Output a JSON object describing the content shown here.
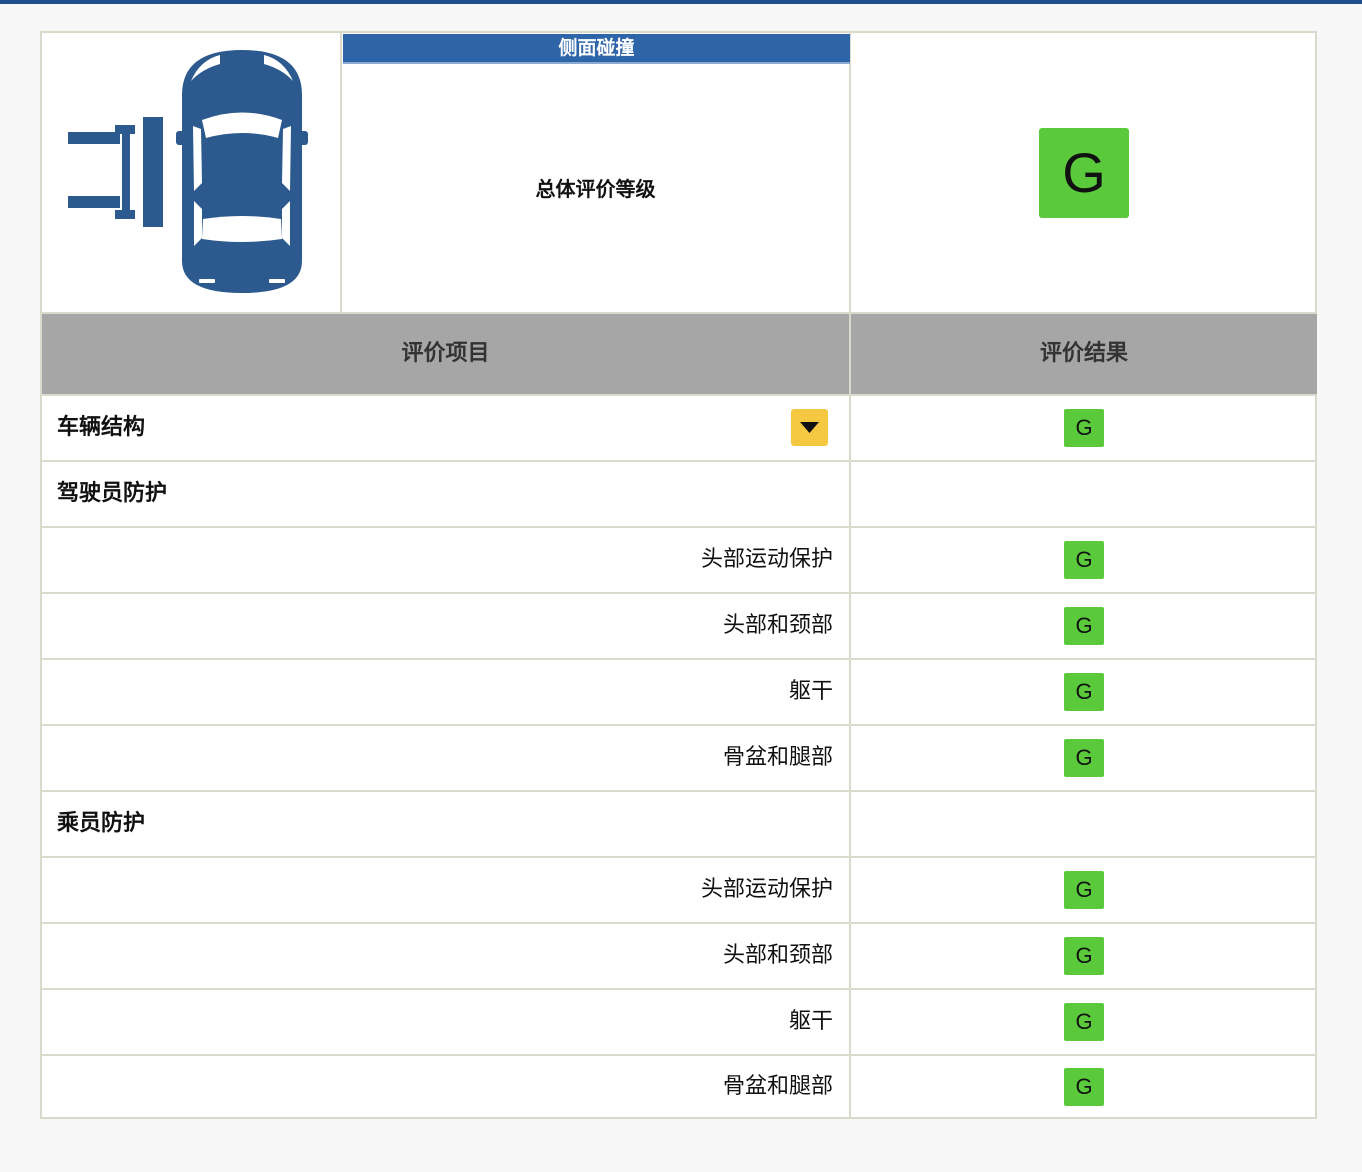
{
  "header": {
    "test_title": "侧面碰撞",
    "overall_label": "总体评价等级",
    "overall_rating": "G"
  },
  "columns": {
    "item": "评价项目",
    "result": "评价结果"
  },
  "rows": [
    {
      "type": "section",
      "label": "车辆结构",
      "rating": "G",
      "has_dropdown": true
    },
    {
      "type": "section",
      "label": "驾驶员防护"
    },
    {
      "type": "item",
      "label": "头部运动保护",
      "rating": "G"
    },
    {
      "type": "item",
      "label": "头部和颈部",
      "rating": "G"
    },
    {
      "type": "item",
      "label": "躯干",
      "rating": "G"
    },
    {
      "type": "item",
      "label": "骨盆和腿部",
      "rating": "G"
    },
    {
      "type": "section",
      "label": "乘员防护"
    },
    {
      "type": "item",
      "label": "头部运动保护",
      "rating": "G"
    },
    {
      "type": "item",
      "label": "头部和颈部",
      "rating": "G"
    },
    {
      "type": "item",
      "label": "躯干",
      "rating": "G"
    },
    {
      "type": "item",
      "label": "骨盆和腿部",
      "rating": "G"
    }
  ],
  "icons": {
    "car": "side-impact-car-icon",
    "dropdown": "chevron-down-icon"
  },
  "colors": {
    "top_bar": "#1f4e8c",
    "title_bg": "#2e64a8",
    "car": "#2d5a8e",
    "header_bg": "#a6a6a6",
    "rating_good": "#5ac93c",
    "dropdown_bg": "#f5c842",
    "border": "#d9d9cc"
  }
}
